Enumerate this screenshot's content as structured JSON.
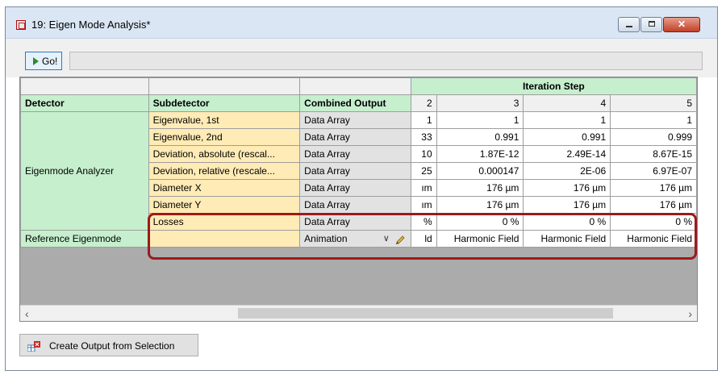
{
  "window": {
    "title": "19: Eigen Mode Analysis*",
    "controls": {
      "minimize": "",
      "maximize": "",
      "close": "✕"
    }
  },
  "toolbar": {
    "go_label": "Go!"
  },
  "grid": {
    "group_header": "Iteration Step",
    "columns": [
      "Detector",
      "Subdetector",
      "Combined Output",
      "2",
      "3",
      "4",
      "5"
    ],
    "detector_main": "Eigenmode Analyzer",
    "detector_ref": "Reference Eigenmode",
    "rows": [
      {
        "sub": "Eigenvalue, 1st",
        "combined": "Data Array",
        "c2": "1",
        "c3": "1",
        "c4": "1",
        "c5": "1"
      },
      {
        "sub": "Eigenvalue, 2nd",
        "combined": "Data Array",
        "c2": "33",
        "c3": "0.991",
        "c4": "0.991",
        "c5": "0.999"
      },
      {
        "sub": "Deviation, absolute (rescal...",
        "combined": "Data Array",
        "c2": "10",
        "c3": "1.87E-12",
        "c4": "2.49E-14",
        "c5": "8.67E-15"
      },
      {
        "sub": "Deviation, relative (rescale...",
        "combined": "Data Array",
        "c2": "25",
        "c3": "0.000147",
        "c4": "2E-06",
        "c5": "6.97E-07"
      },
      {
        "sub": "Diameter X",
        "combined": "Data Array",
        "c2": "ım",
        "c3": "176 µm",
        "c4": "176 µm",
        "c5": "176 µm"
      },
      {
        "sub": "Diameter Y",
        "combined": "Data Array",
        "c2": "ım",
        "c3": "176 µm",
        "c4": "176 µm",
        "c5": "176 µm"
      },
      {
        "sub": "Losses",
        "combined": "Data Array",
        "c2": "%",
        "c3": "0 %",
        "c4": "0 %",
        "c5": "0 %"
      }
    ],
    "ref_row": {
      "combined": "Animation",
      "c2": "ld",
      "c3": "Harmonic Field",
      "c4": "Harmonic Field",
      "c5": "Harmonic Field"
    }
  },
  "scrollbar": {
    "left_arrow": "‹",
    "right_arrow": "›"
  },
  "bottom": {
    "create_output_label": "Create Output from Selection"
  },
  "colors": {
    "detector_bg": "#c6efcd",
    "subdetector_bg": "#ffebb5",
    "combined_bg": "#e2e2e2",
    "highlight": "#9b1b1b"
  }
}
